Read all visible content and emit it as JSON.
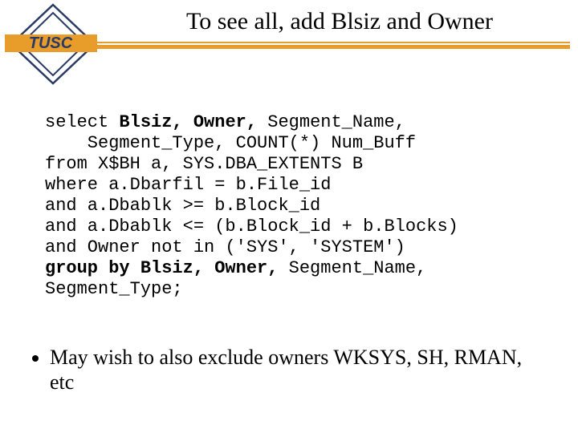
{
  "logo_text": "TUSC",
  "title": "To see all, add Blsiz and Owner",
  "code": {
    "l1a": "select ",
    "l1b": "Blsiz, Owner,",
    "l1c": " Segment_Name,",
    "l2": "    Segment_Type, COUNT(*) Num_Buff",
    "l3": "from X$BH a, SYS.DBA_EXTENTS B",
    "l4": "where a.Dbarfil = b.File_id",
    "l5": "and a.Dbablk >= b.Block_id",
    "l6": "and a.Dbablk <= (b.Block_id + b.Blocks)",
    "l7": "and Owner not in ('SYS', 'SYSTEM')",
    "l8a": "group by Blsiz, Owner,",
    "l8b": " Segment_Name,",
    "l9": "Segment_Type;"
  },
  "bullet1": "May wish to also exclude owners WKSYS, SH, RMAN, etc"
}
